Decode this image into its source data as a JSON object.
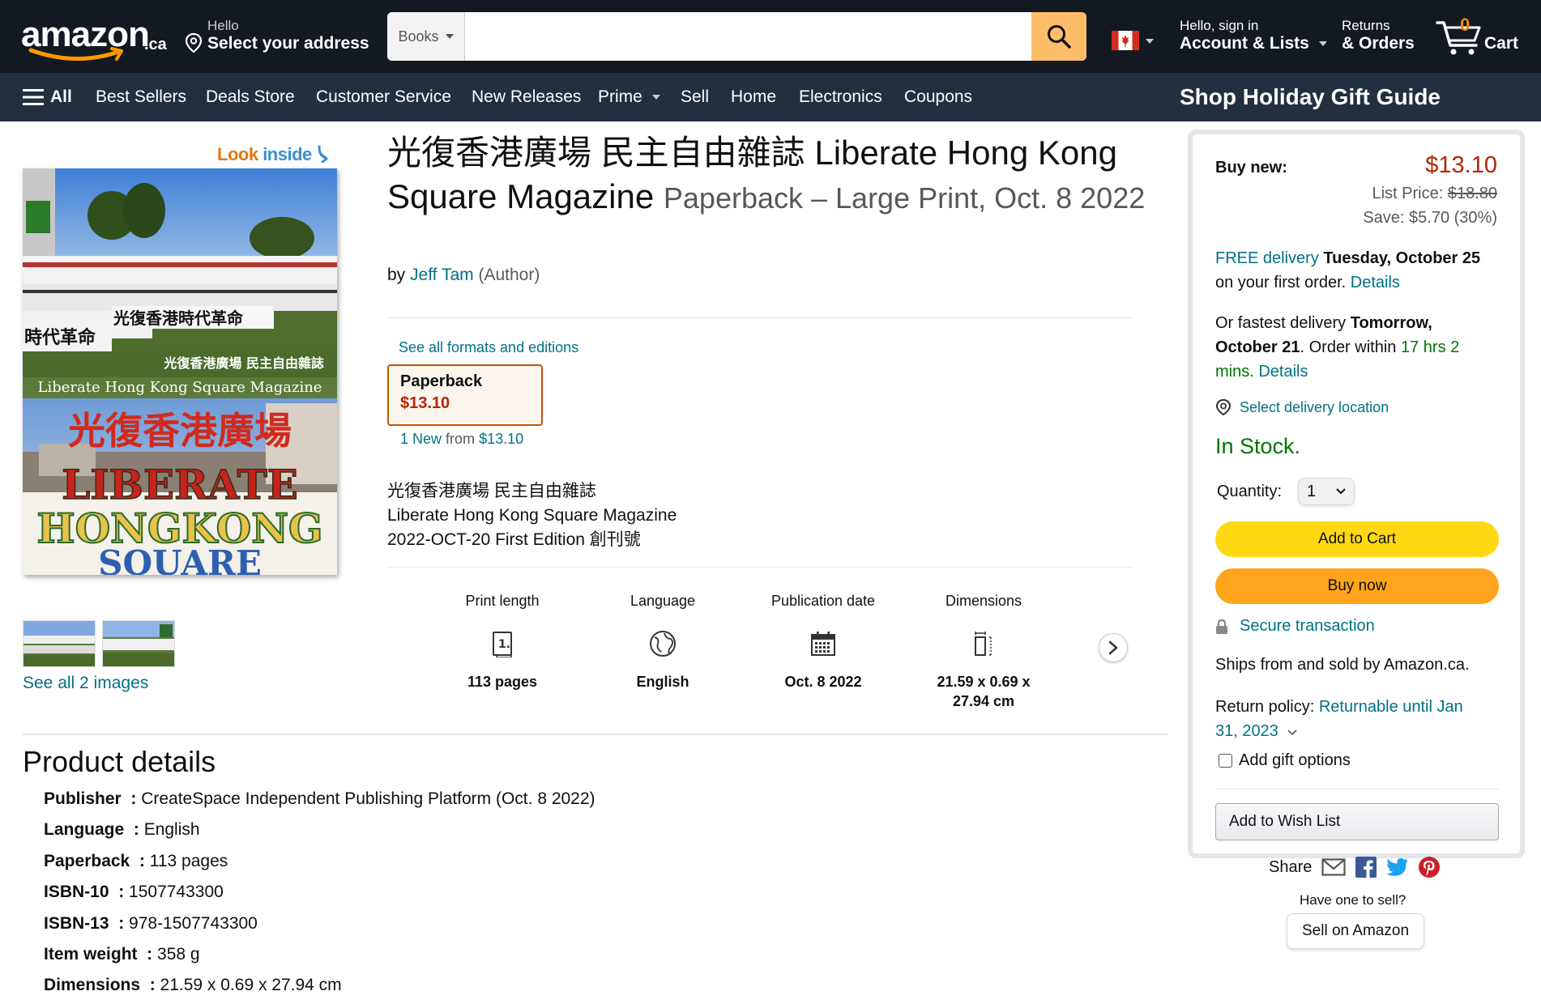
{
  "header": {
    "logo_text": "amazon",
    "logo_tld": ".ca",
    "address_line1": "Hello",
    "address_line2": "Select your address",
    "search_category": "Books",
    "search_placeholder": "",
    "account_line1": "Hello, sign in",
    "account_line2": "Account & Lists",
    "orders_line1": "Returns",
    "orders_line2": "& Orders",
    "cart_count": "0",
    "cart_label": "Cart"
  },
  "nav": {
    "all": "All",
    "items": [
      "Best Sellers",
      "Deals Store",
      "Customer Service",
      "New Releases",
      "Prime",
      "Sell",
      "Home",
      "Electronics",
      "Coupons"
    ],
    "holiday": "Shop Holiday Gift Guide"
  },
  "images": {
    "look_inside_1": "Look",
    "look_inside_2": "inside",
    "cover_banner_cn": "光復香港廣場 民主自由雜誌",
    "cover_banner_en": "Liberate Hong Kong Square Magazine",
    "cover_sign_cn": "光復香港廣場",
    "cover_sign_en1": "LIBERATE",
    "cover_sign_en2": "HONGKONG",
    "cover_sign_en3": "SQUARE",
    "cover_banner_top": "光復香港時代革命",
    "cover_banner_left": "時代革命",
    "see_all_images": "See all 2 images"
  },
  "product": {
    "title": "光復香港廣場 民主自由雜誌 Liberate Hong Kong Square Magazine",
    "format_subtitle": "Paperback – Large Print, Oct. 8 2022",
    "by": "by",
    "author": "Jeff Tam",
    "author_role": "(Author)",
    "see_formats": "See all formats and editions",
    "format_name": "Paperback",
    "format_price": "$13.10",
    "new_from_count": "1 New",
    "new_from_word": "from",
    "new_from_price": "$13.10",
    "description": [
      "光復香港廣場 民主自由雜誌",
      "Liberate Hong Kong Square Magazine",
      "2022-OCT-20 First Edition 創刊號"
    ]
  },
  "specs": [
    {
      "label": "Print length",
      "icon": "book-pages-icon",
      "value": "113 pages"
    },
    {
      "label": "Language",
      "icon": "globe-icon",
      "value": "English"
    },
    {
      "label": "Publication date",
      "icon": "calendar-icon",
      "value": "Oct. 8 2022"
    },
    {
      "label": "Dimensions",
      "icon": "dimensions-icon",
      "value": "21.59 x 0.69 x 27.94 cm"
    }
  ],
  "details": {
    "title": "Product details",
    "rows": [
      {
        "k": "Publisher",
        "v": "CreateSpace Independent Publishing Platform (Oct. 8 2022)"
      },
      {
        "k": "Language",
        "v": "English"
      },
      {
        "k": "Paperback",
        "v": "113 pages"
      },
      {
        "k": "ISBN-10",
        "v": "1507743300"
      },
      {
        "k": "ISBN-13",
        "v": "978-1507743300"
      },
      {
        "k": "Item weight",
        "v": "358 g"
      },
      {
        "k": "Dimensions",
        "v": "21.59 x 0.69 x 27.94 cm"
      }
    ]
  },
  "buybox": {
    "buy_new": "Buy new:",
    "price": "$13.10",
    "list_price_label": "List Price:",
    "list_price": "$18.80",
    "save": "Save: $5.70 (30%)",
    "free_delivery": "FREE delivery",
    "delivery_date": "Tuesday, October 25",
    "first_order": "on your first order.",
    "details": "Details",
    "fastest_prefix": "Or fastest delivery",
    "fastest_date1": "Tomorrow,",
    "fastest_date2": "October 21",
    "order_within": ". Order within",
    "countdown1": "17 hrs 2",
    "countdown2": "mins.",
    "select_location": "Select delivery location",
    "stock": "In Stock.",
    "quantity_label": "Quantity:",
    "quantity_value": "1",
    "add_to_cart": "Add to Cart",
    "buy_now": "Buy now",
    "secure": "Secure transaction",
    "ships_from": "Ships from and sold by Amazon.ca.",
    "return_label": "Return policy:",
    "return_value1": "Returnable until Jan",
    "return_value2": "31, 2023",
    "gift": "Add gift options",
    "wish_list": "Add to Wish List"
  },
  "share": {
    "label": "Share",
    "have_one": "Have one to sell?",
    "sell": "Sell on Amazon"
  },
  "colors": {
    "header_bg": "#131921",
    "nav_bg": "#232f3e",
    "link": "#007185",
    "price_red": "#b12704",
    "stock_green": "#007600",
    "add_to_cart": "#ffd814",
    "buy_now": "#ffa41c",
    "search_button": "#febd69"
  }
}
